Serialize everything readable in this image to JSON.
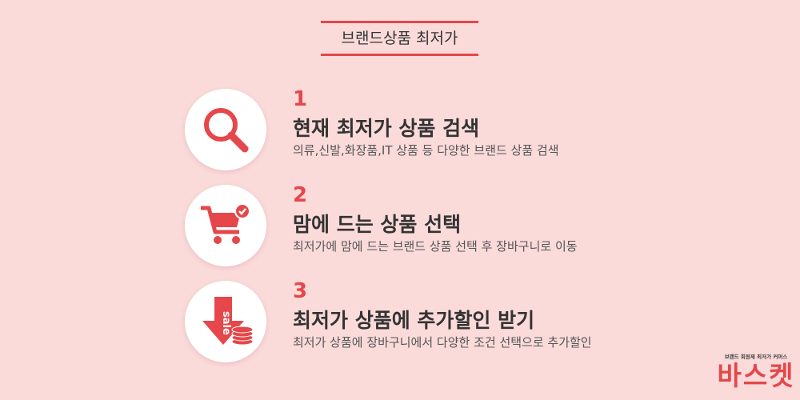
{
  "title": "브랜드상품 최저가",
  "steps": [
    {
      "number": "1",
      "heading": "현재 최저가 상품 검색",
      "description": "의류,신발,화장품,IT 상품 등 다양한 브랜드 상품 검색",
      "icon": "search-icon"
    },
    {
      "number": "2",
      "heading": "맘에 드는 상품 선택",
      "description": "최저가에 맘에 드는 브랜드 상품 선택 후 장바구니로 이동",
      "icon": "cart-check-icon"
    },
    {
      "number": "3",
      "heading": "최저가 상품에 추가할인 받기",
      "description": "최저가 상품에 장바구니에서 다양한 조건 선택으로 추가할인",
      "icon": "sale-arrow-icon",
      "icon_text": "sale"
    }
  ],
  "logo": {
    "tagline": "브랜드 회원제 최저가 커머스",
    "name": "바스켓"
  },
  "colors": {
    "accent": "#e5474a",
    "background": "#fbdada"
  }
}
